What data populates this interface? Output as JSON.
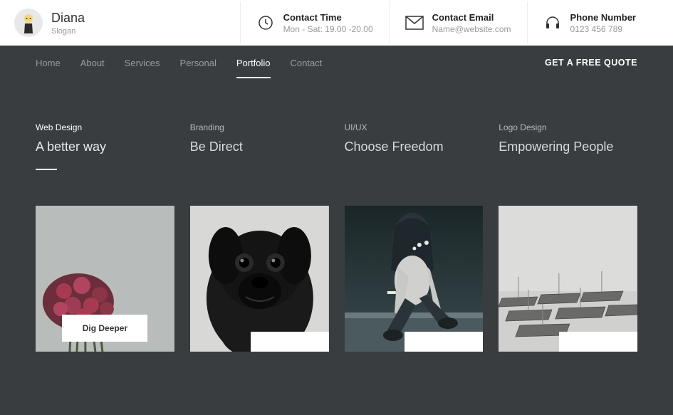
{
  "brand": {
    "name": "Diana",
    "slogan": "Slogan"
  },
  "header": {
    "contacts": [
      {
        "icon": "clock-icon",
        "label": "Contact Time",
        "value": "Mon - Sat: 19.00 -20.00"
      },
      {
        "icon": "mail-icon",
        "label": "Contact Email",
        "value": "Name@website.com"
      },
      {
        "icon": "headphones-icon",
        "label": "Phone Number",
        "value": "0123 456 789"
      }
    ]
  },
  "nav": {
    "links": [
      "Home",
      "About",
      "Services",
      "Personal",
      "Portfolio",
      "Contact"
    ],
    "active_index": 4,
    "cta": "GET A FREE QUOTE"
  },
  "categories": [
    {
      "label": "Web Design",
      "title": "A better way",
      "active": true
    },
    {
      "label": "Branding",
      "title": "Be Direct",
      "active": false
    },
    {
      "label": "UI/UX",
      "title": "Choose Freedom",
      "active": false
    },
    {
      "label": "Logo Design",
      "title": "Empowering People",
      "active": false
    }
  ],
  "cards": [
    {
      "tag": "Dig Deeper"
    },
    {
      "tag": ""
    },
    {
      "tag": ""
    },
    {
      "tag": ""
    }
  ]
}
